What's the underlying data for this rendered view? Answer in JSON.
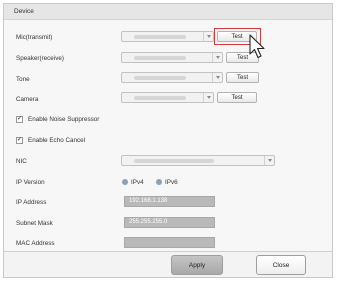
{
  "section": {
    "title": "Device"
  },
  "rows": {
    "mic": {
      "label": "Mic(transmit)",
      "test_label": "Test"
    },
    "speaker": {
      "label": "Speaker(receive)",
      "test_label": "Test"
    },
    "tone": {
      "label": "Tone",
      "test_label": "Test"
    },
    "camera": {
      "label": "Camera",
      "test_label": "Test"
    }
  },
  "checkboxes": [
    {
      "label": "Enable Noise Suppressor",
      "checked": true,
      "mark": "✓"
    },
    {
      "label": "Enable Echo Cancel",
      "checked": true,
      "mark": "✓"
    }
  ],
  "nic": {
    "label": "NIC"
  },
  "ip_version": {
    "label": "IP Version",
    "options": [
      "IPv4",
      "IPv6"
    ]
  },
  "ip_address": {
    "label": "IP Address",
    "value": "192.168.1.138"
  },
  "subnet_mask": {
    "label": "Subnet Mask",
    "value": "255.255.255.0"
  },
  "mac_address": {
    "label": "MAC Address",
    "value": ""
  },
  "footer": {
    "apply_label": "Apply",
    "close_label": "Close"
  },
  "colors": {
    "highlight": "#d93a3a",
    "radio": "#8aa1b6",
    "readonly_field": "#b9b9b9"
  },
  "icons": {
    "cursor": "mouse-pointer-icon",
    "dropdown": "chevron-down-icon"
  }
}
